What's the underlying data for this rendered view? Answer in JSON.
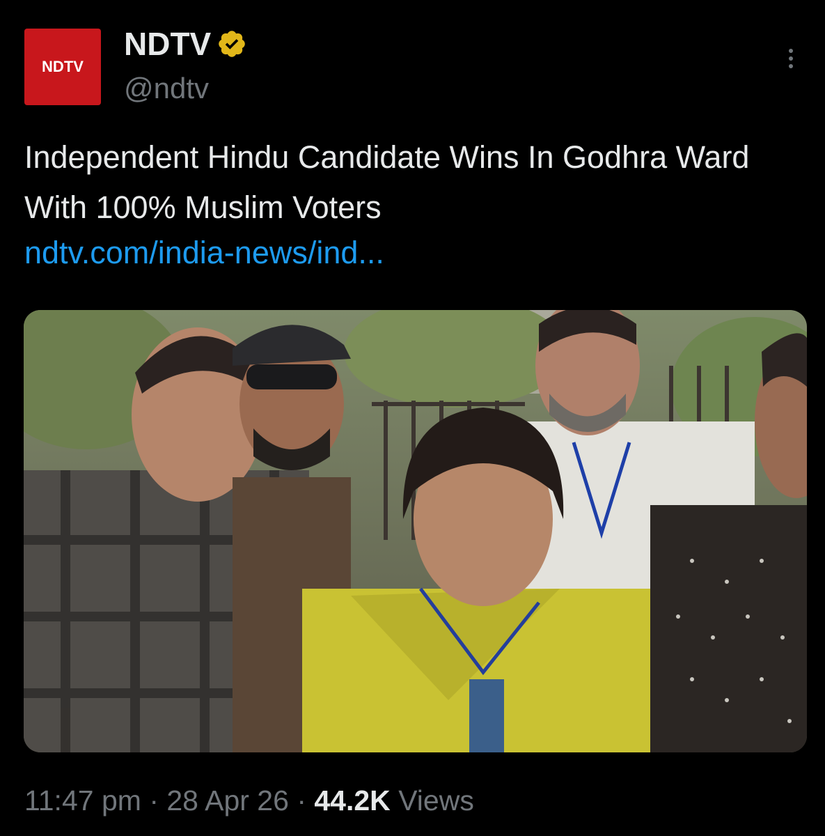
{
  "account": {
    "logo_text": "NDTV",
    "name": "NDTV",
    "handle": "@ndtv",
    "verified_badge": "verified-gold-icon"
  },
  "post": {
    "headline": "Independent Hindu Candidate Wins In Godhra Ward With 100% Muslim Voters",
    "link": "ndtv.com/india-news/ind..."
  },
  "meta": {
    "time": "11:47 pm",
    "separator": "·",
    "date": "28 Apr 26",
    "views_count": "44.2K",
    "views_label": "Views"
  },
  "colors": {
    "background": "#000000",
    "text": "#e7e9ea",
    "muted": "#71767b",
    "link": "#1d9bf0",
    "brand_red": "#c8171c",
    "badge_gold": "#e2b719"
  }
}
